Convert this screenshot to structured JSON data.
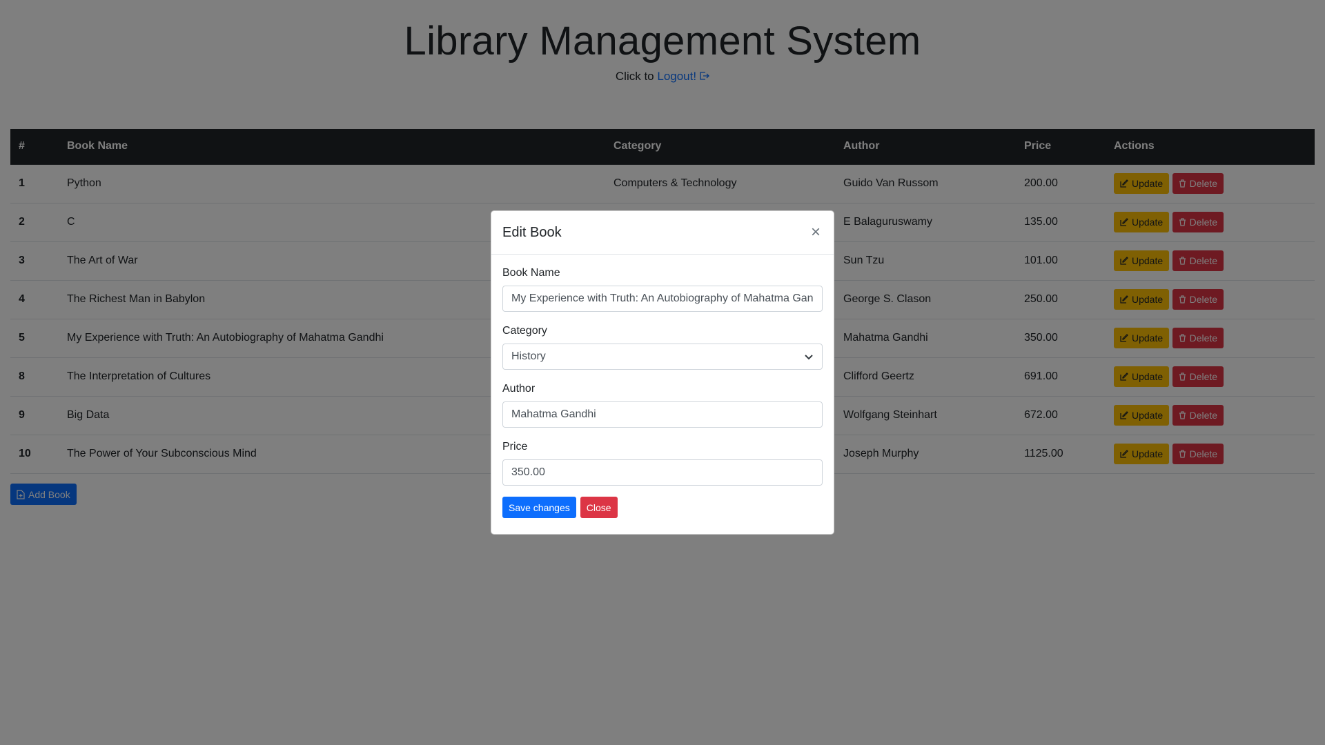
{
  "header": {
    "title": "Library Management System",
    "logout_prefix": "Click to",
    "logout_link": "Logout!"
  },
  "table": {
    "columns": [
      "#",
      "Book Name",
      "Category",
      "Author",
      "Price",
      "Actions"
    ],
    "rows": [
      {
        "idx": "1",
        "name": "Python",
        "category": "Computers & Technology",
        "author": "Guido Van Russom",
        "price": "200.00"
      },
      {
        "idx": "2",
        "name": "C",
        "category": "",
        "author": "E Balaguruswamy",
        "price": "135.00"
      },
      {
        "idx": "3",
        "name": "The Art of War",
        "category": "",
        "author": "Sun Tzu",
        "price": "101.00"
      },
      {
        "idx": "4",
        "name": "The Richest Man in Babylon",
        "category": "",
        "author": "George S. Clason",
        "price": "250.00"
      },
      {
        "idx": "5",
        "name": "My Experience with Truth: An Autobiography of Mahatma Gandhi",
        "category": "",
        "author": "Mahatma Gandhi",
        "price": "350.00"
      },
      {
        "idx": "8",
        "name": "The Interpretation of Cultures",
        "category": "",
        "author": "Clifford Geertz",
        "price": "691.00"
      },
      {
        "idx": "9",
        "name": "Big Data",
        "category": "",
        "author": "Wolfgang Steinhart",
        "price": "672.00"
      },
      {
        "idx": "10",
        "name": "The Power of Your Subconscious Mind",
        "category": "",
        "author": "Joseph Murphy",
        "price": "1125.00"
      }
    ],
    "update_label": "Update",
    "delete_label": "Delete"
  },
  "add_book_label": "Add Book",
  "modal": {
    "title": "Edit Book",
    "close_glyph": "×",
    "book_name_label": "Book Name",
    "book_name_value": "My Experience with Truth: An Autobiography of Mahatma Gandhi",
    "category_label": "Category",
    "category_value": "History",
    "author_label": "Author",
    "author_value": "Mahatma Gandhi",
    "price_label": "Price",
    "price_value": "350.00",
    "save_label": "Save changes",
    "close_label": "Close"
  },
  "colors": {
    "primary": "#0d6efd",
    "warning": "#ffc107",
    "danger": "#dc3545",
    "dark": "#212529"
  },
  "icons": {
    "logout": "logout-icon",
    "update": "edit-icon",
    "delete": "trash-icon",
    "add": "file-plus-icon",
    "select": "chevron-down-icon",
    "close": "close-icon"
  }
}
